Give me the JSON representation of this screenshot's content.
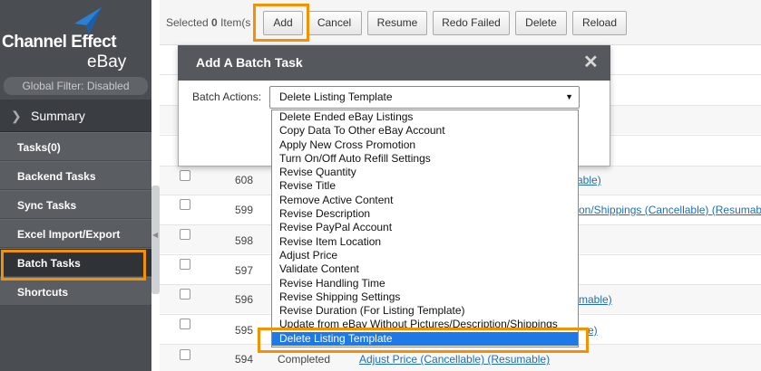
{
  "brand": {
    "line1": "Channel Effect",
    "line2": "eBay"
  },
  "sidebar": {
    "global_filter": "Global Filter: Disabled",
    "summary": "Summary",
    "items": [
      {
        "label": "Tasks(0)"
      },
      {
        "label": "Backend Tasks"
      },
      {
        "label": "Sync Tasks"
      },
      {
        "label": "Excel Import/Export"
      },
      {
        "label": "Batch Tasks"
      },
      {
        "label": "Shortcuts"
      }
    ]
  },
  "toolbar": {
    "selected_prefix": "Selected ",
    "selected_count": "0",
    "selected_suffix": " Item(s",
    "buttons": [
      "Add",
      "Cancel",
      "Resume",
      "Redo Failed",
      "Delete",
      "Reload"
    ]
  },
  "rows": [
    {
      "id": "608",
      "status": "",
      "link": "able)"
    },
    {
      "id": "599",
      "status": "",
      "link": "on/Shippings (Cancellable) (Resumabl"
    },
    {
      "id": "598",
      "status": "",
      "link": ""
    },
    {
      "id": "597",
      "status": "",
      "link": ""
    },
    {
      "id": "596",
      "status": "",
      "link": "mable)"
    },
    {
      "id": "595",
      "status": "",
      "link": "e)"
    },
    {
      "id": "594",
      "status": "Completed",
      "link": "Adjust Price (Cancellable) (Resumable)"
    }
  ],
  "dialog": {
    "title": "Add A Batch Task",
    "close_glyph": "✕",
    "field_label": "Batch Actions:",
    "selected_value": "Delete Listing Template",
    "options": [
      "Delete Ended eBay Listings",
      "Copy Data To Other eBay Account",
      "Apply New Cross Promotion",
      "Turn On/Off Auto Refill Settings",
      "Revise Quantity",
      "Revise Title",
      "Remove Active Content",
      "Revise Description",
      "Revise PayPal Account",
      "Revise Item Location",
      "Adjust Price",
      "Validate Content",
      "Revise Handling Time",
      "Revise Shipping Settings",
      "Revise Duration (For Listing Template)",
      "Update from eBay Without Pictures/Description/Shippings",
      "Delete Listing Template"
    ]
  },
  "colors": {
    "highlight": "#f39200",
    "selected_option": "#1e78e6",
    "link": "#1f6fb5"
  }
}
